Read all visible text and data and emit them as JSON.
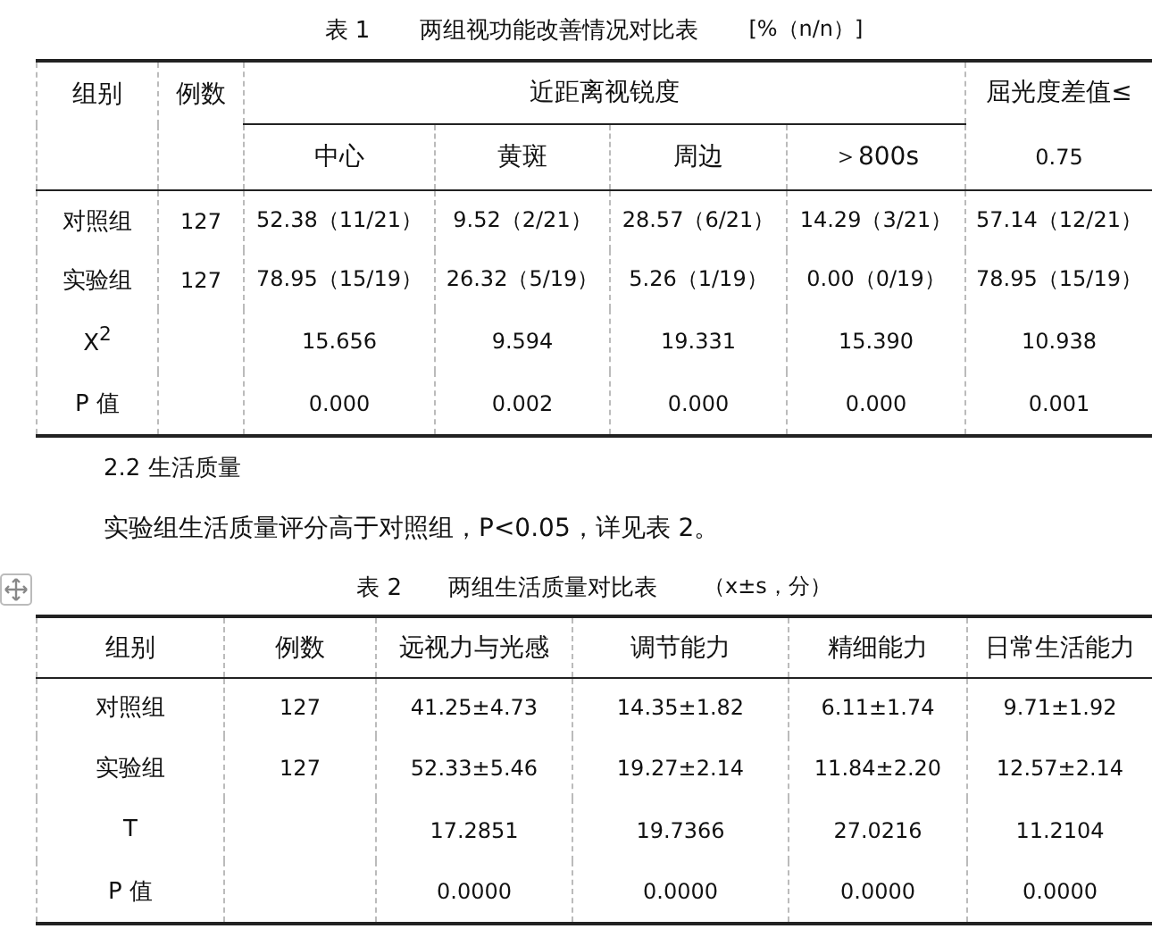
{
  "table_1": {
    "caption": {
      "label": "表 1",
      "title": "两组视功能改善情况对比表",
      "unit": "[%（n/n）]"
    },
    "header": [
      {
        "kind": "single",
        "label": "组别"
      },
      {
        "kind": "single",
        "label": "例数"
      },
      {
        "kind": "group",
        "label": "近距离视锐度",
        "children": [
          "中心",
          "黄斑",
          "周边",
          "＞800s"
        ]
      },
      {
        "kind": "stacked",
        "label": "屈光度差值≤",
        "sublabel": "0.75"
      }
    ],
    "rows": [
      {
        "group": "对照组",
        "count": "127",
        "values": [
          "52.38（11/21）",
          "9.52（2/21）",
          "28.57（6/21）",
          "14.29（3/21）",
          "57.14（12/21）"
        ]
      },
      {
        "group": "实验组",
        "count": "127",
        "values": [
          "78.95（15/19）",
          "26.32（5/19）",
          "5.26（1/19）",
          "0.00（0/19）",
          "78.95（15/19）"
        ]
      },
      {
        "group": "X$^{2}$",
        "values": [
          "15.656",
          "9.594",
          "19.331",
          "15.390",
          "10.938"
        ]
      },
      {
        "group": "P 值",
        "values": [
          "0.000",
          "0.002",
          "0.000",
          "0.000",
          "0.001"
        ]
      }
    ]
  },
  "section_heading": "2.2 生活质量",
  "paragraph": "实验组生活质量评分高于对照组，P<0.05，详见表 2。",
  "table_2": {
    "caption": {
      "label": "表 2",
      "title": "两组生活质量对比表",
      "unit": "（x±s，分）"
    },
    "header": [
      {
        "kind": "single",
        "label": "组别"
      },
      {
        "kind": "single",
        "label": "例数"
      },
      {
        "kind": "single",
        "label": "远视力与光感"
      },
      {
        "kind": "single",
        "label": "调节能力"
      },
      {
        "kind": "single",
        "label": "精细能力"
      },
      {
        "kind": "single",
        "label": "日常生活能力"
      }
    ],
    "rows": [
      {
        "group": "对照组",
        "count": "127",
        "values": [
          "41.25±4.73",
          "14.35±1.82",
          "6.11±1.74",
          "9.71±1.92"
        ]
      },
      {
        "group": "实验组",
        "count": "127",
        "values": [
          "52.33±5.46",
          "19.27±2.14",
          "11.84±2.20",
          "12.57±2.14"
        ]
      },
      {
        "group": "T",
        "values": [
          "17.2851",
          "19.7366",
          "27.0216",
          "11.2104"
        ]
      },
      {
        "group": "P 值",
        "values": [
          "0.0000",
          "0.0000",
          "0.0000",
          "0.0000"
        ]
      }
    ]
  }
}
